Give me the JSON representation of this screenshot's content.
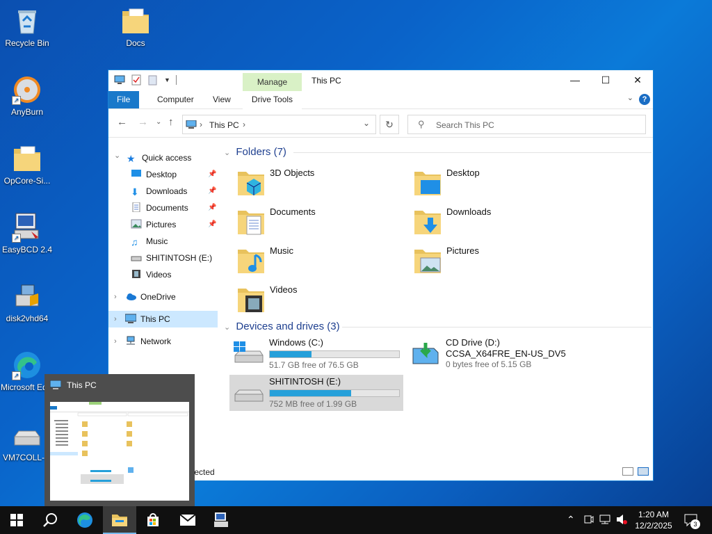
{
  "desktop": {
    "icons": [
      {
        "label": "Recycle Bin"
      },
      {
        "label": "Docs"
      },
      {
        "label": "AnyBurn"
      },
      {
        "label": "OpCore-Si..."
      },
      {
        "label": "EasyBCD 2.4"
      },
      {
        "label": "disk2vhd64"
      },
      {
        "label": "Microsoft Edge"
      },
      {
        "label": "VM7COLL-..."
      }
    ]
  },
  "window": {
    "title": "This PC",
    "ribbon": {
      "contextual_group": "Manage",
      "tabs": [
        "File",
        "Computer",
        "View",
        "Drive Tools"
      ],
      "help": "?"
    },
    "address": {
      "path": "This PC",
      "search_placeholder": "Search This PC"
    },
    "nav": {
      "quick_access": "Quick access",
      "quick_items": [
        {
          "label": "Desktop",
          "pinned": true
        },
        {
          "label": "Downloads",
          "pinned": true
        },
        {
          "label": "Documents",
          "pinned": true
        },
        {
          "label": "Pictures",
          "pinned": true
        },
        {
          "label": "Music",
          "pinned": false
        },
        {
          "label": "SHITINTOSH (E:)",
          "pinned": false
        },
        {
          "label": "Videos",
          "pinned": false
        }
      ],
      "onedrive": "OneDrive",
      "this_pc": "This PC",
      "network": "Network"
    },
    "folders_header": "Folders (7)",
    "folders": [
      {
        "name": "3D Objects",
        "icon": "3d-objects-icon"
      },
      {
        "name": "Desktop",
        "icon": "desktop-folder-icon"
      },
      {
        "name": "Documents",
        "icon": "documents-folder-icon"
      },
      {
        "name": "Downloads",
        "icon": "downloads-folder-icon"
      },
      {
        "name": "Music",
        "icon": "music-folder-icon"
      },
      {
        "name": "Pictures",
        "icon": "pictures-folder-icon"
      },
      {
        "name": "Videos",
        "icon": "videos-folder-icon"
      }
    ],
    "drives_header": "Devices and drives (3)",
    "drives": [
      {
        "name": "Windows (C:)",
        "free": "51.7 GB free of 76.5 GB",
        "used_fraction": 0.32
      },
      {
        "name": "CD Drive (D:)",
        "sub": "CCSA_X64FRE_EN-US_DV5",
        "free": "0 bytes free of 5.15 GB"
      },
      {
        "name": "SHITINTOSH (E:)",
        "free": "752 MB free of 1.99 GB",
        "used_fraction": 0.63
      }
    ],
    "status_text": "elected"
  },
  "preview": {
    "title": "This PC"
  },
  "taskbar": {
    "time": "1:20 AM",
    "date": "12/2/2025",
    "notifications": "3"
  }
}
